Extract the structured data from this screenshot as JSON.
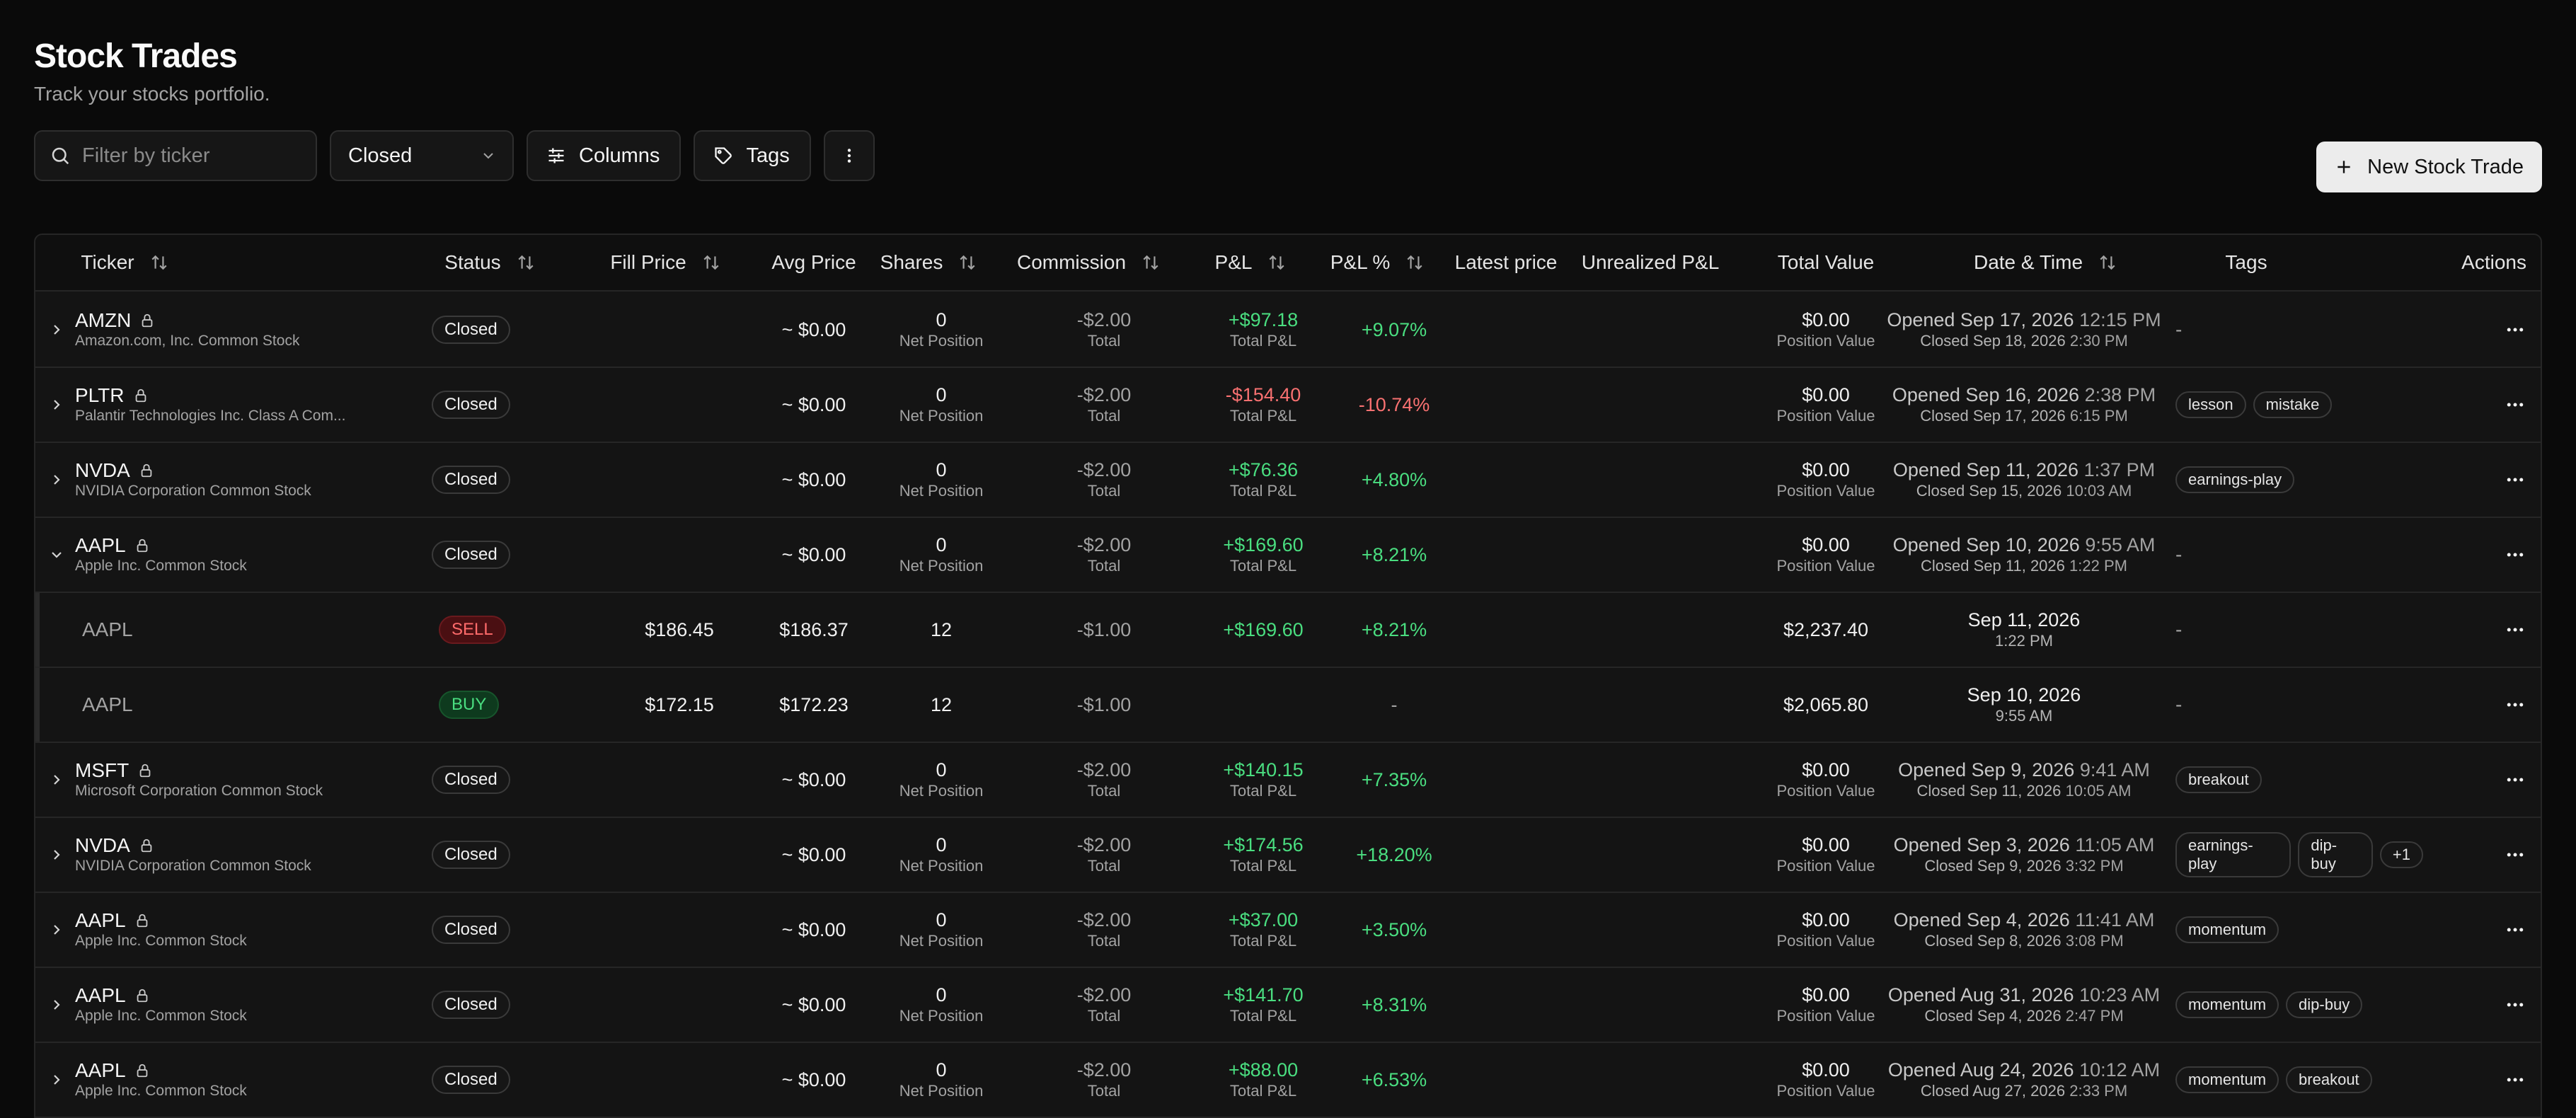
{
  "header": {
    "title": "Stock Trades",
    "subtitle": "Track your stocks portfolio."
  },
  "toolbar": {
    "search_placeholder": "Filter by ticker",
    "status_filter": "Closed",
    "columns_label": "Columns",
    "tags_label": "Tags",
    "new_trade_label": "New Stock Trade"
  },
  "columns": {
    "ticker": "Ticker",
    "status": "Status",
    "fill_price": "Fill Price",
    "avg_price": "Avg Price",
    "shares": "Shares",
    "commission": "Commission",
    "pnl": "P&L",
    "pnl_pct": "P&L %",
    "latest_price": "Latest price",
    "unrealized": "Unrealized P&L",
    "total_value": "Total Value",
    "datetime": "Date & Time",
    "tags": "Tags",
    "actions": "Actions"
  },
  "labels": {
    "net_position": "Net Position",
    "total": "Total",
    "total_pnl": "Total P&L",
    "position_value": "Position Value",
    "dash": "-"
  },
  "rows": [
    {
      "ticker": "AMZN",
      "company": "Amazon.com, Inc. Common Stock",
      "status": "Closed",
      "avg": "~ $0.00",
      "shares": "0",
      "commission": "-$2.00",
      "pnl": "+$97.18",
      "pnl_pct": "+9.07%",
      "value": "$0.00",
      "opened": "Opened Sep 17, 2026",
      "opened_time": "12:15 PM",
      "closed": "Closed Sep 18, 2026",
      "closed_time": "2:30 PM",
      "tags": []
    },
    {
      "ticker": "PLTR",
      "company": "Palantir Technologies Inc. Class A Com...",
      "status": "Closed",
      "avg": "~ $0.00",
      "shares": "0",
      "commission": "-$2.00",
      "pnl": "-$154.40",
      "pnl_pct": "-10.74%",
      "value": "$0.00",
      "opened": "Opened Sep 16, 2026",
      "opened_time": "2:38 PM",
      "closed": "Closed Sep 17, 2026",
      "closed_time": "6:15 PM",
      "tags": [
        "lesson",
        "mistake"
      ]
    },
    {
      "ticker": "NVDA",
      "company": "NVIDIA Corporation Common Stock",
      "status": "Closed",
      "avg": "~ $0.00",
      "shares": "0",
      "commission": "-$2.00",
      "pnl": "+$76.36",
      "pnl_pct": "+4.80%",
      "value": "$0.00",
      "opened": "Opened Sep 11, 2026",
      "opened_time": "1:37 PM",
      "closed": "Closed Sep 15, 2026",
      "closed_time": "10:03 AM",
      "tags": [
        "earnings-play"
      ]
    },
    {
      "ticker": "AAPL",
      "company": "Apple Inc. Common Stock",
      "status": "Closed",
      "avg": "~ $0.00",
      "shares": "0",
      "commission": "-$2.00",
      "pnl": "+$169.60",
      "pnl_pct": "+8.21%",
      "value": "$0.00",
      "opened": "Opened Sep 10, 2026",
      "opened_time": "9:55 AM",
      "closed": "Closed Sep 11, 2026",
      "closed_time": "1:22 PM",
      "tags": [],
      "expanded": true
    },
    {
      "ticker": "MSFT",
      "company": "Microsoft Corporation Common Stock",
      "status": "Closed",
      "avg": "~ $0.00",
      "shares": "0",
      "commission": "-$2.00",
      "pnl": "+$140.15",
      "pnl_pct": "+7.35%",
      "value": "$0.00",
      "opened": "Opened Sep 9, 2026",
      "opened_time": "9:41 AM",
      "closed": "Closed Sep 11, 2026",
      "closed_time": "10:05 AM",
      "tags": [
        "breakout"
      ]
    },
    {
      "ticker": "NVDA",
      "company": "NVIDIA Corporation Common Stock",
      "status": "Closed",
      "avg": "~ $0.00",
      "shares": "0",
      "commission": "-$2.00",
      "pnl": "+$174.56",
      "pnl_pct": "+18.20%",
      "value": "$0.00",
      "opened": "Opened Sep 3, 2026",
      "opened_time": "11:05 AM",
      "closed": "Closed Sep 9, 2026",
      "closed_time": "3:32 PM",
      "tags": [
        "earnings-play",
        "dip-buy",
        "+1"
      ]
    },
    {
      "ticker": "AAPL",
      "company": "Apple Inc. Common Stock",
      "status": "Closed",
      "avg": "~ $0.00",
      "shares": "0",
      "commission": "-$2.00",
      "pnl": "+$37.00",
      "pnl_pct": "+3.50%",
      "value": "$0.00",
      "opened": "Opened Sep 4, 2026",
      "opened_time": "11:41 AM",
      "closed": "Closed Sep 8, 2026",
      "closed_time": "3:08 PM",
      "tags": [
        "momentum"
      ]
    },
    {
      "ticker": "AAPL",
      "company": "Apple Inc. Common Stock",
      "status": "Closed",
      "avg": "~ $0.00",
      "shares": "0",
      "commission": "-$2.00",
      "pnl": "+$141.70",
      "pnl_pct": "+8.31%",
      "value": "$0.00",
      "opened": "Opened Aug 31, 2026",
      "opened_time": "10:23 AM",
      "closed": "Closed Sep 4, 2026",
      "closed_time": "2:47 PM",
      "tags": [
        "momentum",
        "dip-buy"
      ]
    },
    {
      "ticker": "AAPL",
      "company": "Apple Inc. Common Stock",
      "status": "Closed",
      "avg": "~ $0.00",
      "shares": "0",
      "commission": "-$2.00",
      "pnl": "+$88.00",
      "pnl_pct": "+6.53%",
      "value": "$0.00",
      "opened": "Opened Aug 24, 2026",
      "opened_time": "10:12 AM",
      "closed": "Closed Aug 27, 2026",
      "closed_time": "2:33 PM",
      "tags": [
        "momentum",
        "breakout"
      ]
    }
  ],
  "children": [
    {
      "ticker": "AAPL",
      "side": "SELL",
      "fill": "$186.45",
      "avg": "$186.37",
      "shares": "12",
      "commission": "-$1.00",
      "pnl": "+$169.60",
      "pnl_pct": "+8.21%",
      "value": "$2,237.40",
      "date": "Sep 11, 2026",
      "time": "1:22 PM"
    },
    {
      "ticker": "AAPL",
      "side": "BUY",
      "fill": "$172.15",
      "avg": "$172.23",
      "shares": "12",
      "commission": "-$1.00",
      "pnl": "",
      "pnl_pct": "-",
      "value": "$2,065.80",
      "date": "Sep 10, 2026",
      "time": "9:55 AM"
    }
  ],
  "colors": {
    "positive": "#4ade80",
    "negative": "#f87171",
    "background": "#0a0a0a"
  }
}
